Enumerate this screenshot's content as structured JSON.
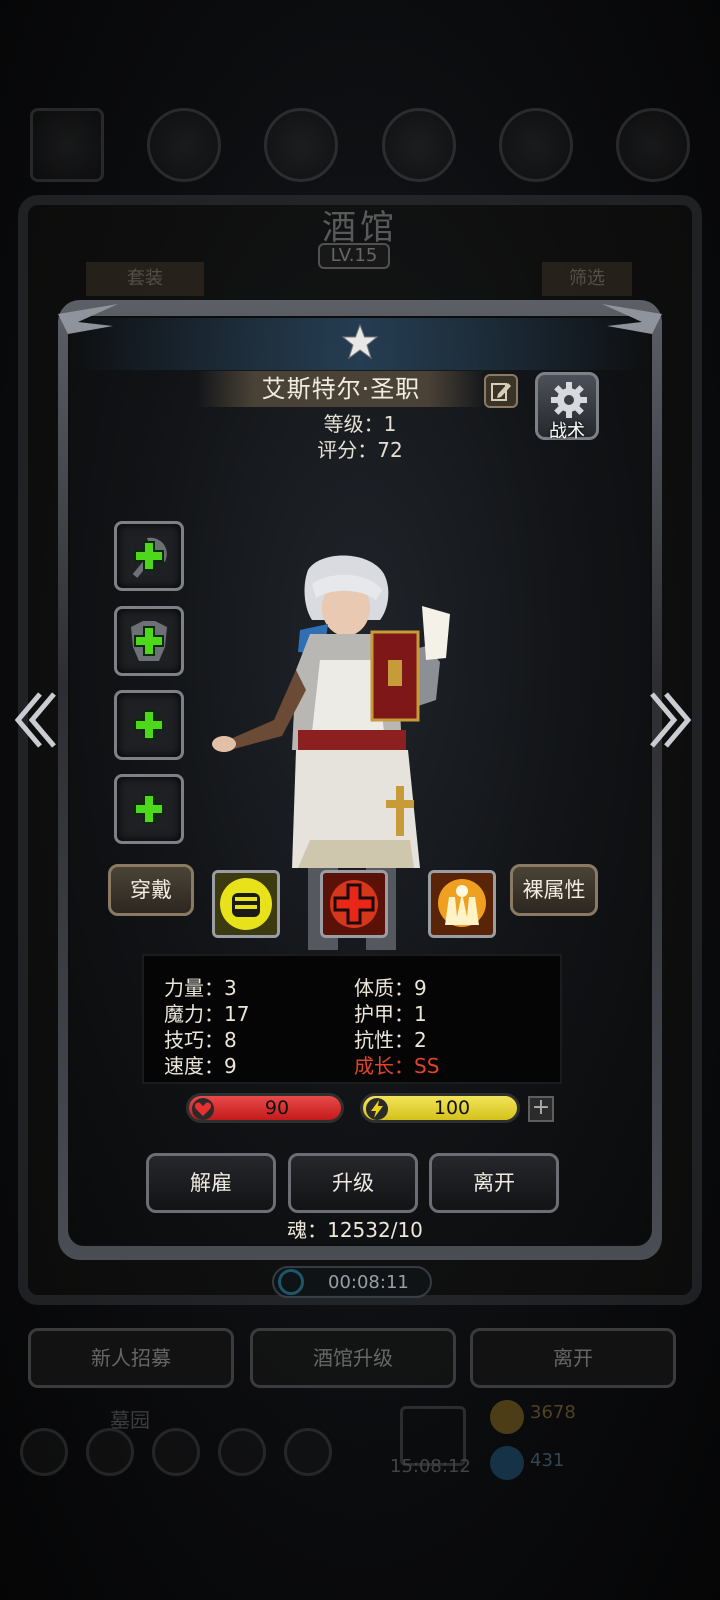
{
  "background": {
    "title": "酒馆",
    "level": "LV.15",
    "tab_left": "套装",
    "tab_right": "筛选",
    "timer": "00:08:11",
    "buttons": [
      "新人招募",
      "酒馆升级",
      "离开"
    ],
    "garden": "墓园",
    "clock": "15:08:12",
    "gold": "3678",
    "gems": "431"
  },
  "hero": {
    "name": "艾斯特尔·圣职",
    "level_text": "等级：1",
    "score_text": "评分：72",
    "tactics_label": "战术"
  },
  "equipment_slots": [
    {
      "slot": "weapon",
      "icon": "axe-silhouette-icon"
    },
    {
      "slot": "armor",
      "icon": "armor-silhouette-icon"
    },
    {
      "slot": "accessory-1",
      "icon": "empty-slot-icon"
    },
    {
      "slot": "accessory-2",
      "icon": "empty-slot-icon"
    }
  ],
  "skills_row": {
    "wear_label": "穿戴",
    "bare_label": "裸属性",
    "skills": [
      "fist-icon",
      "heal-cross-icon",
      "holy-hands-icon"
    ]
  },
  "stats": {
    "strength": "力量：3",
    "magic": "魔力：17",
    "skill": "技巧：8",
    "speed": "速度：9",
    "constitution": "体质：9",
    "armor": "护甲：1",
    "resistance": "抗性：2",
    "growth": "成长：SS"
  },
  "bars": {
    "hp": "90",
    "energy": "100",
    "hp_fraction": 1.0,
    "energy_fraction": 1.0,
    "hp_color": "#c41a1a",
    "energy_color": "#d4c21a"
  },
  "actions": {
    "dismiss": "解雇",
    "upgrade": "升级",
    "leave": "离开"
  },
  "soul_text": "魂：12532/10",
  "colors": {
    "growth_red": "#e0442c",
    "plus_green": "#4ed81c"
  }
}
